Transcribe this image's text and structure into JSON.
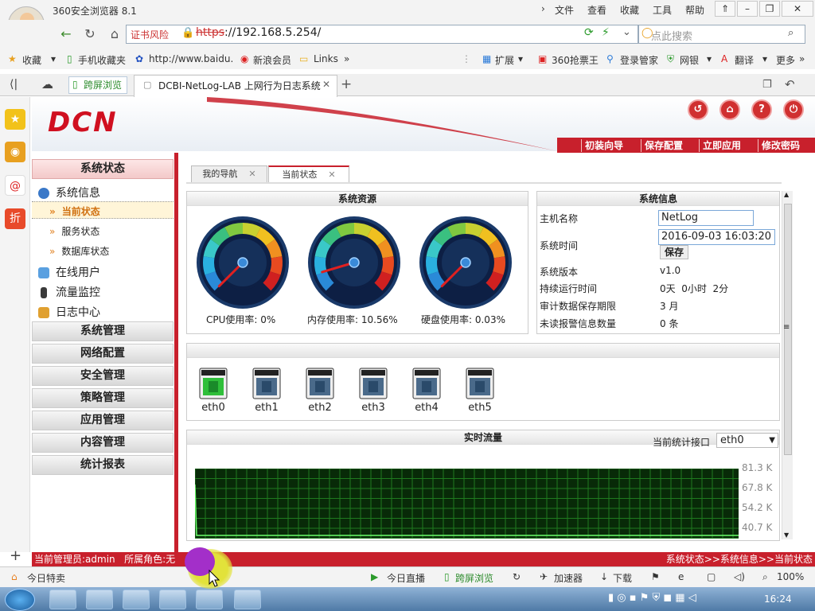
{
  "browser": {
    "app_title": "360安全浏览器 8.1",
    "menu": [
      "文件",
      "查看",
      "收藏",
      "工具",
      "帮助"
    ],
    "cert_warning": "证书风险",
    "url_scheme": "https",
    "url_rest": "://192.168.5.254/",
    "search_placeholder": "点此搜索",
    "bookmarks": [
      "收藏",
      "手机收藏夹",
      "http://www.baidu.",
      "新浪会员",
      "Links"
    ],
    "toolbar_right": [
      "扩展",
      "360抢票王",
      "登录管家",
      "网银",
      "翻译",
      "更多"
    ],
    "tab_split": "跨屏浏览",
    "tab_active": "DCBI-NetLog-LAB 上网行为日志系统",
    "bottom_items": [
      "今日特卖",
      "今日直播",
      "跨屏浏览",
      "加速器",
      "下载",
      "100%"
    ],
    "clock": "16:24"
  },
  "app": {
    "logo": "DCN",
    "header_links": [
      "初装向导",
      "保存配置",
      "立即应用",
      "修改密码"
    ],
    "sidebar": {
      "status_title": "系统状态",
      "system_info": "系统信息",
      "leaves": [
        "当前状态",
        "服务状态",
        "数据库状态"
      ],
      "online_users": "在线用户",
      "traffic_monitor": "流量监控",
      "log_center": "日志中心",
      "sections": [
        "系统管理",
        "网络配置",
        "安全管理",
        "策略管理",
        "应用管理",
        "内容管理",
        "统计报表"
      ]
    },
    "content_tabs": [
      "我的导航",
      "当前状态"
    ],
    "resources": {
      "title": "系统资源",
      "gauges": [
        {
          "label": "CPU使用率: 0%",
          "percent": 0
        },
        {
          "label": "内存使用率: 10.56%",
          "percent": 10.56
        },
        {
          "label": "硬盘使用率: 0.03%",
          "percent": 0.03
        }
      ]
    },
    "sysinfo": {
      "title": "系统信息",
      "hostname_label": "主机名称",
      "hostname_value": "NetLog",
      "time_label": "系统时间",
      "time_value": "2016-09-03 16:03:20",
      "save_label": "保存",
      "version_label": "系统版本",
      "version_value": "v1.0",
      "uptime_label": "持续运行时间",
      "uptime_value": "0天  0小时  2分",
      "retention_label": "审计数据保存期限",
      "retention_value": "3 月",
      "alarm_label": "未读报警信息数量",
      "alarm_value": "0 条"
    },
    "ports": [
      {
        "name": "eth0",
        "link": true
      },
      {
        "name": "eth1",
        "link": false
      },
      {
        "name": "eth2",
        "link": false
      },
      {
        "name": "eth3",
        "link": false
      },
      {
        "name": "eth4",
        "link": false
      },
      {
        "name": "eth5",
        "link": false
      }
    ],
    "traffic": {
      "title": "实时流量",
      "interface_label": "当前统计接口",
      "interface_value": "eth0",
      "y_labels": [
        "81.3 K",
        "67.8 K",
        "54.2 K",
        "40.7 K"
      ]
    },
    "status": {
      "admin": "当前管理员:admin   所属角色:无",
      "breadcrumb": "系统状态>>系统信息>>当前状态"
    }
  },
  "colors": {
    "brand_red": "#c8202c",
    "link_green": "#2fbf3a",
    "accent_orange": "#e08020"
  }
}
